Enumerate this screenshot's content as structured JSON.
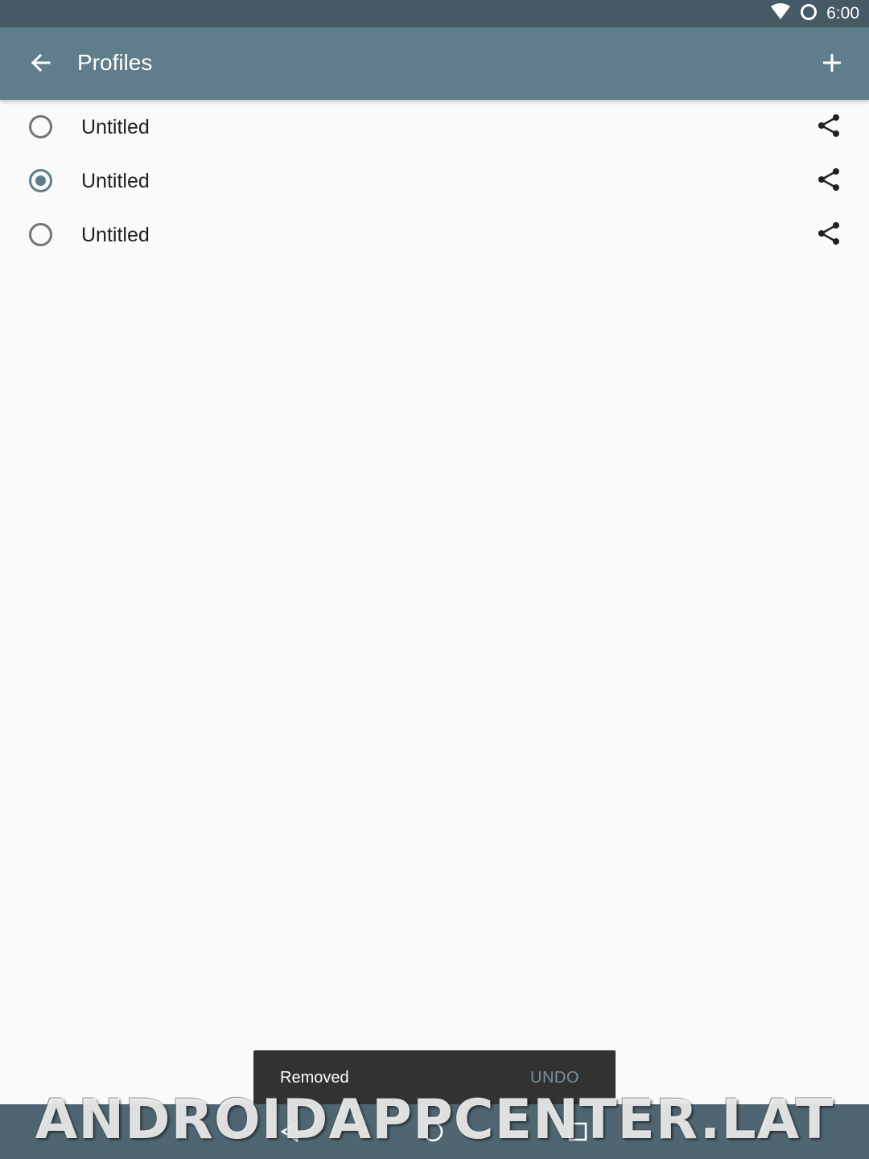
{
  "status_bar": {
    "time": "6:00",
    "icons": [
      "wifi-icon",
      "sync-circle-icon"
    ]
  },
  "app_bar": {
    "title": "Profiles",
    "back_icon": "arrow-back-icon",
    "add_icon": "add-icon"
  },
  "profiles": [
    {
      "label": "Untitled",
      "selected": false
    },
    {
      "label": "Untitled",
      "selected": true
    },
    {
      "label": "Untitled",
      "selected": false
    }
  ],
  "snackbar": {
    "message": "Removed",
    "action": "UNDO"
  },
  "nav_bar": {
    "icons": [
      "back-triangle-icon",
      "home-circle-icon",
      "recents-square-icon"
    ]
  },
  "watermark": {
    "text": "ANDROIDAPPCENTER.LAT"
  },
  "colors": {
    "status_bar": "#455a64",
    "app_bar": "#607d8b",
    "accent": "#607d8b",
    "snackbar": "#323232",
    "snackbar_action": "#78909c",
    "background": "#fafafa"
  }
}
